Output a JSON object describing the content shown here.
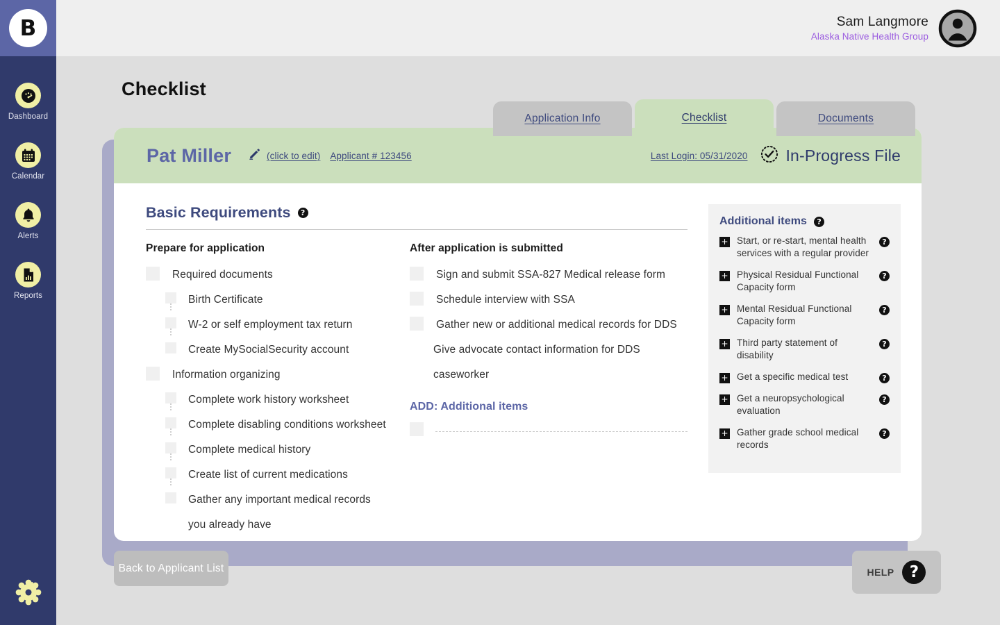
{
  "brand": {
    "initial": "B"
  },
  "sidebar": {
    "items": [
      {
        "label": "Dashboard",
        "icon": "gauge-icon"
      },
      {
        "label": "Calendar",
        "icon": "calendar-icon"
      },
      {
        "label": "Alerts",
        "icon": "bell-icon"
      },
      {
        "label": "Reports",
        "icon": "report-document-icon"
      }
    ],
    "settings_icon": "gear-icon"
  },
  "topbar": {
    "user_name": "Sam Langmore",
    "user_org": "Alaska Native Health Group",
    "avatar_icon": "user-avatar-icon"
  },
  "page": {
    "title": "Checklist"
  },
  "tabs": [
    {
      "label": "Application Info",
      "active": false
    },
    {
      "label": "Checklist",
      "active": true
    },
    {
      "label": "Documents",
      "active": false
    }
  ],
  "applicant": {
    "name": "Pat Miller",
    "edit_link": "(click to edit)",
    "edit_icon": "pencil-icon",
    "applicant_number": "Applicant # 123456",
    "last_login": "Last Login: 05/31/2020",
    "status": "In-Progress File",
    "status_icon": "dashed-check-circle-icon"
  },
  "section": {
    "title": "Basic Requirements",
    "help_icon": "question-mark-icon",
    "left_column": {
      "heading": "Prepare for application",
      "items": [
        {
          "label": "Required documents",
          "level": 0,
          "checkbox": true,
          "checked": false
        },
        {
          "label": "Birth Certificate",
          "level": 1,
          "checkbox": true,
          "checked": false
        },
        {
          "label": "W-2 or self employment tax return",
          "level": 1,
          "checkbox": true,
          "checked": false
        },
        {
          "label": "Create MySocialSecurity account",
          "level": 1,
          "checkbox": true,
          "checked": false
        },
        {
          "label": "Information organizing",
          "level": 0,
          "checkbox": true,
          "checked": false
        },
        {
          "label": "Complete work history worksheet",
          "level": 1,
          "checkbox": true,
          "checked": false
        },
        {
          "label": "Complete disabling conditions worksheet",
          "level": 1,
          "checkbox": true,
          "checked": false
        },
        {
          "label": "Complete medical history",
          "level": 1,
          "checkbox": true,
          "checked": false
        },
        {
          "label": "Create list of current medications",
          "level": 1,
          "checkbox": true,
          "checked": false
        },
        {
          "label": "Gather any important medical records",
          "level": 1,
          "checkbox": true,
          "checked": false
        },
        {
          "label": "you already have",
          "level": 1,
          "checkbox": false,
          "checked": false
        }
      ]
    },
    "right_column": {
      "heading": "After application is submitted",
      "items": [
        {
          "label": "Sign and submit SSA-827 Medical release form",
          "level": 0,
          "checkbox": true,
          "checked": false
        },
        {
          "label": "Schedule interview with SSA",
          "level": 0,
          "checkbox": true,
          "checked": false
        },
        {
          "label": "Gather new or additional medical records for DDS",
          "level": 0,
          "checkbox": true,
          "checked": false
        },
        {
          "label": "Give advocate contact information for DDS",
          "level": 0,
          "checkbox": false,
          "checked": false
        },
        {
          "label": "caseworker",
          "level": 0,
          "checkbox": false,
          "checked": false
        }
      ],
      "add_title": "ADD: Additional items",
      "add_input_value": "",
      "add_input_placeholder": ""
    }
  },
  "additional_items": {
    "title": "Additional items",
    "help_icon": "question-mark-icon",
    "add_icon": "plus-icon",
    "items": [
      {
        "label": "Start, or re-start, mental health services with a regular provider"
      },
      {
        "label": "Physical Residual Functional Capacity form"
      },
      {
        "label": "Mental Residual Functional Capacity form"
      },
      {
        "label": "Third party statement of disability"
      },
      {
        "label": "Get a specific medical test"
      },
      {
        "label": "Get a neuropsychological evaluation"
      },
      {
        "label": "Gather grade school medical records"
      }
    ]
  },
  "footer": {
    "back_label": "Back to Applicant List",
    "help_label": "HELP",
    "help_icon": "question-mark-icon"
  },
  "colors": {
    "sidebar_bg": "#303A6B",
    "brand_bg": "#5C66A6",
    "accent_yellow": "#F0EFA5",
    "page_bg": "#DEDEDE",
    "card_shadow": "#A9AAC8",
    "green_header": "#CBDFBC",
    "tab_inactive": "#C4C4C4",
    "link_purple": "#9B5CE0",
    "heading_blue": "#3E4A7E",
    "name_blue": "#5C66A6"
  }
}
